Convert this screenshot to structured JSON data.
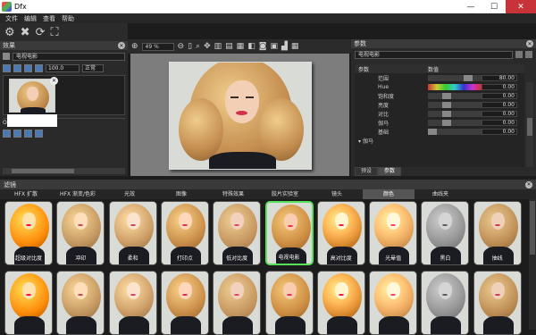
{
  "window": {
    "title": "Dfx",
    "minimize": "—",
    "maximize": "☐",
    "close": "✕"
  },
  "menu": [
    "文件",
    "编辑",
    "查看",
    "帮助"
  ],
  "toolbar_icons": {
    "gear": "⚙",
    "delete": "✖",
    "refresh": "⟳",
    "fit": "⛶"
  },
  "effects_panel": {
    "title": "效果",
    "preset_name": "电视电影",
    "opacity_value": "100.0",
    "blend_mode": "正常",
    "original_label": "Original"
  },
  "view_toolbar": {
    "zoom": "49 %"
  },
  "params_panel": {
    "title": "参数",
    "preset_name": "电视电影",
    "col_param": "参数",
    "col_value": "数值",
    "rows": [
      {
        "name": "范围",
        "value": "80.00",
        "level": 0.8
      },
      {
        "name": "Hue",
        "value": "0.00",
        "level": 0.0
      },
      {
        "name": "饱和度",
        "value": "0.00",
        "level": 0.3
      },
      {
        "name": "亮度",
        "value": "0.00",
        "level": 0.3
      },
      {
        "name": "对比",
        "value": "0.00",
        "level": 0.3
      },
      {
        "name": "伽马",
        "value": "0.00",
        "level": 0.3
      },
      {
        "name": "基础",
        "value": "0.00",
        "level": 0.0
      }
    ],
    "group_label": "伽马",
    "tabs": [
      "预设",
      "参数"
    ]
  },
  "filters_panel": {
    "title": "滤镜",
    "tabs": [
      "HFX 扩散",
      "HFX 渐变/色彩",
      "光效",
      "图像",
      "特殊效果",
      "胶片实验室",
      "镜头",
      "颜色",
      "曲线夹"
    ],
    "active_tab": "颜色",
    "presets_row1": [
      "超级对比度",
      "冲印",
      "柔和",
      "打印点",
      "低对比度",
      "电视电影",
      "高对比度",
      "光晕值",
      "黑白",
      "抽线"
    ],
    "selected": "电视电影"
  },
  "colors": {
    "selection": "#59e05b",
    "close_button": "#c8333a"
  }
}
